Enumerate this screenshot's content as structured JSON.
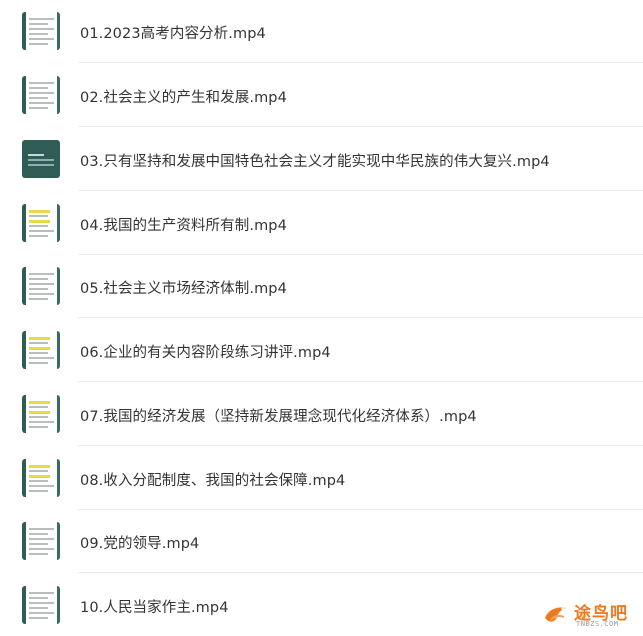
{
  "files": [
    {
      "name": "01.2023高考内容分析.mp4",
      "thumb": "light"
    },
    {
      "name": "02.社会主义的产生和发展.mp4",
      "thumb": "light"
    },
    {
      "name": "03.只有坚持和发展中国特色社会主义才能实现中华民族的伟大复兴.mp4",
      "thumb": "dark"
    },
    {
      "name": "04.我国的生产资料所有制.mp4",
      "thumb": "highlight"
    },
    {
      "name": "05.社会主义市场经济体制.mp4",
      "thumb": "light"
    },
    {
      "name": "06.企业的有关内容阶段练习讲评.mp4",
      "thumb": "highlight"
    },
    {
      "name": "07.我国的经济发展（坚持新发展理念现代化经济体系）.mp4",
      "thumb": "highlight"
    },
    {
      "name": "08.收入分配制度、我国的社会保障.mp4",
      "thumb": "highlight"
    },
    {
      "name": "09.党的领导.mp4",
      "thumb": "light"
    },
    {
      "name": "10.人民当家作主.mp4",
      "thumb": "light"
    }
  ],
  "watermark": {
    "logo_text": "途鸟吧",
    "sub_text": "TNBZS.COM",
    "color": "#ee7a1f"
  }
}
